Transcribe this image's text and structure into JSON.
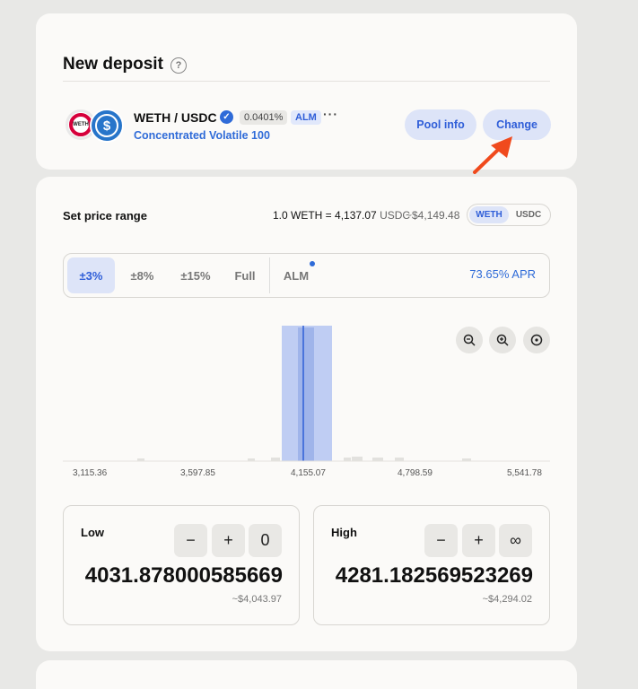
{
  "deposit": {
    "title": "New deposit",
    "help_icon": "?",
    "pair": "WETH / USDC",
    "token_a_icon_text": "WETH",
    "token_b_icon_text": "$",
    "fee": "0.0401%",
    "alm_badge": "ALM",
    "more": "···",
    "strategy": "Concentrated Volatile 100",
    "pool_info_label": "Pool info",
    "change_label": "Change"
  },
  "range": {
    "title": "Set price range",
    "rate_prefix": "1.0 WETH = 4,137.07",
    "rate_unit": "USDC",
    "usd": "~$4,149.48",
    "toggle": [
      "WETH",
      "USDC"
    ],
    "active_token": "WETH",
    "presets": [
      "±3%",
      "±8%",
      "±15%",
      "Full"
    ],
    "alm_label": "ALM",
    "apr": "73.65% APR",
    "ticks": [
      "3,115.36",
      "3,597.85",
      "4,155.07",
      "4,798.59",
      "5,541.78"
    ],
    "low": {
      "label": "Low",
      "minus": "−",
      "plus": "+",
      "extra": "0",
      "value": "4031.878000585669",
      "usd": "~$4,043.97"
    },
    "high": {
      "label": "High",
      "minus": "−",
      "plus": "+",
      "extra": "∞",
      "value": "4281.182569523269",
      "usd": "~$4,294.02"
    }
  },
  "colors": {
    "accent": "#2f6bd8",
    "accent_bg": "#dde4f8",
    "arrow": "#f04a1d"
  }
}
